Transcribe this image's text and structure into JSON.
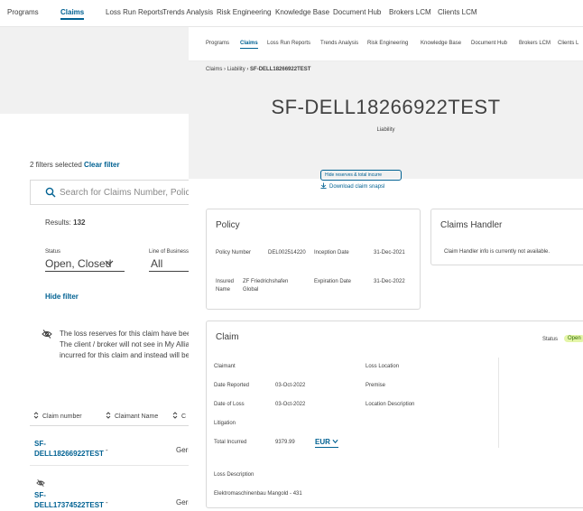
{
  "bg_nav": {
    "items": [
      "Programs",
      "Claims",
      "Loss Run Reports",
      "Trends Analysis",
      "Risk Engineering",
      "Knowledge Base",
      "Document Hub",
      "Brokers LCM",
      "Clients LCM"
    ],
    "active": "Claims"
  },
  "filters": {
    "selected_text": "2 filters selected",
    "clear_label": "Clear filter",
    "search_placeholder": "Search for Claims Number, Policy Numl",
    "results_label": "Results:",
    "results_count": "132",
    "status_label": "Status",
    "status_value": "Open, Closed",
    "lob_label": "Line of Business",
    "lob_value": "All",
    "hide_filter": "Hide filter"
  },
  "notice": {
    "lines": [
      "The loss reserves for this claim have been mor",
      "The client / broker will not see in My Allianz Cl",
      "incurred for this claim and instead will be pror"
    ]
  },
  "table": {
    "headers": [
      "Claim number",
      "Claimant Name",
      "C"
    ],
    "rows": [
      {
        "number_l1": "SF-",
        "number_l2": "DELL18266922TEST",
        "claimant": "-",
        "country": "Germ"
      },
      {
        "number_l1": "SF-",
        "number_l2": "DELL17374522TEST",
        "claimant": "-",
        "country": "Germ"
      }
    ]
  },
  "window": {
    "nav": [
      "Programs",
      "Claims",
      "Loss Run Reports",
      "Trends Analysis",
      "Risk Engineering",
      "Knowledge Base",
      "Document Hub",
      "Brokers LCM",
      "Clients L"
    ],
    "breadcrumb": [
      "Claims",
      "Liability",
      "SF-DELL18266922TEST"
    ],
    "title": "SF-DELL18266922TEST",
    "subtitle": "Liability",
    "hide_reserves_btn": "Hide reserves & total incurre",
    "download_label": "Download claim snapsl"
  },
  "policy": {
    "title": "Policy",
    "policy_number_label": "Policy Number",
    "policy_number": "DEL002514220",
    "inception_label": "Inception Date",
    "inception_date": "31-Dec-2021",
    "insured_label_1": "Insured",
    "insured_label_2": "Name",
    "insured_1": "ZF Friedrichshafen",
    "insured_2": "Global",
    "expiration_label": "Expiration Date",
    "expiration_date": "31-Dec-2022"
  },
  "handler": {
    "title": "Claims Handler",
    "message": "Claim Handler info is currently not available."
  },
  "claim": {
    "title": "Claim",
    "status_label": "Status",
    "status_value": "Open",
    "claimant_label": "Claimant",
    "date_reported_label": "Date Reported",
    "date_reported": "03-Oct-2022",
    "date_of_loss_label": "Date of Loss",
    "date_of_loss": "03-Oct-2022",
    "litigation_label": "Litigation",
    "total_incurred_label": "Total Incurred",
    "total_incurred": "9379.99",
    "currency": "EUR",
    "loss_location_label": "Loss Location",
    "premise_label": "Premise",
    "location_desc_label": "Location Description",
    "loss_desc_label": "Loss Description",
    "loss_desc": "Elektromaschinenbau Mangold - 431"
  },
  "colors": {
    "link": "#006192",
    "hero_bg": "#f1f1f1",
    "badge_bg": "#e4f5a8"
  }
}
